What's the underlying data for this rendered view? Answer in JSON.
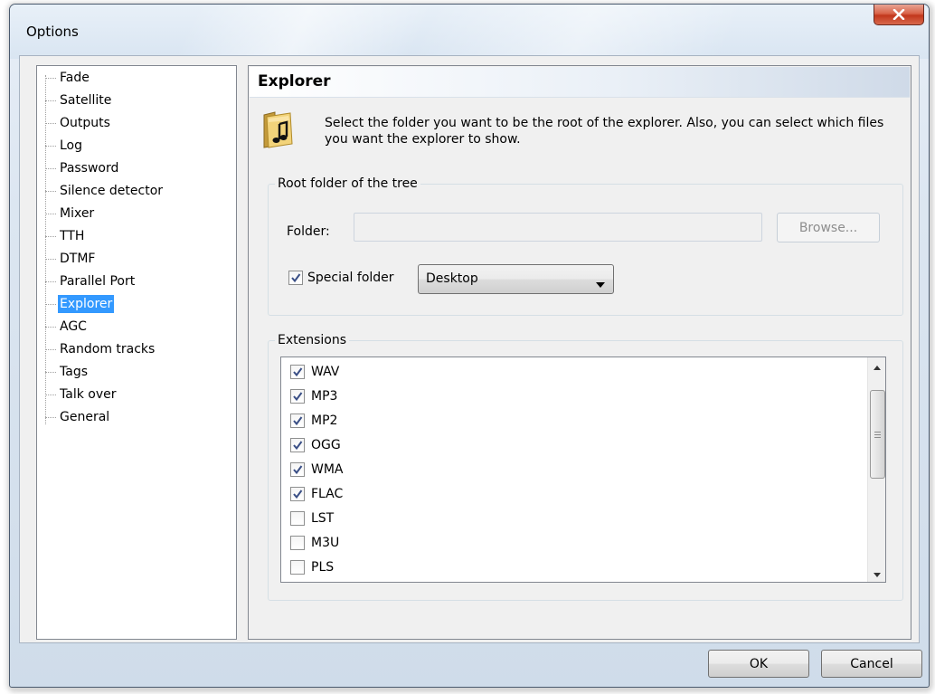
{
  "window": {
    "title": "Options"
  },
  "tree": {
    "items": [
      {
        "label": "Fade",
        "selected": false
      },
      {
        "label": "Satellite",
        "selected": false
      },
      {
        "label": "Outputs",
        "selected": false
      },
      {
        "label": "Log",
        "selected": false
      },
      {
        "label": "Password",
        "selected": false
      },
      {
        "label": "Silence detector",
        "selected": false
      },
      {
        "label": "Mixer",
        "selected": false
      },
      {
        "label": "TTH",
        "selected": false
      },
      {
        "label": "DTMF",
        "selected": false
      },
      {
        "label": "Parallel Port",
        "selected": false
      },
      {
        "label": "Explorer",
        "selected": true
      },
      {
        "label": "AGC",
        "selected": false
      },
      {
        "label": "Random tracks",
        "selected": false
      },
      {
        "label": "Tags",
        "selected": false
      },
      {
        "label": "Talk over",
        "selected": false
      },
      {
        "label": "General",
        "selected": false
      }
    ]
  },
  "panel": {
    "title": "Explorer",
    "icon": "music-folder-icon",
    "description": "Select the folder you want to be the root of the explorer. Also, you can select which files you want the explorer to show.",
    "root_group": {
      "legend": "Root folder of the tree",
      "folder_label": "Folder:",
      "folder_value": "",
      "browse_label": "Browse...",
      "special_folder_label": "Special folder",
      "special_folder_checked": true,
      "special_folder_value": "Desktop"
    },
    "extensions_group": {
      "legend": "Extensions",
      "items": [
        {
          "label": "WAV",
          "checked": true
        },
        {
          "label": "MP3",
          "checked": true
        },
        {
          "label": "MP2",
          "checked": true
        },
        {
          "label": "OGG",
          "checked": true
        },
        {
          "label": "WMA",
          "checked": true
        },
        {
          "label": "FLAC",
          "checked": true
        },
        {
          "label": "LST",
          "checked": false
        },
        {
          "label": "M3U",
          "checked": false
        },
        {
          "label": "PLS",
          "checked": false
        },
        {
          "label": "",
          "checked": false
        }
      ]
    }
  },
  "footer": {
    "ok_label": "OK",
    "cancel_label": "Cancel"
  }
}
